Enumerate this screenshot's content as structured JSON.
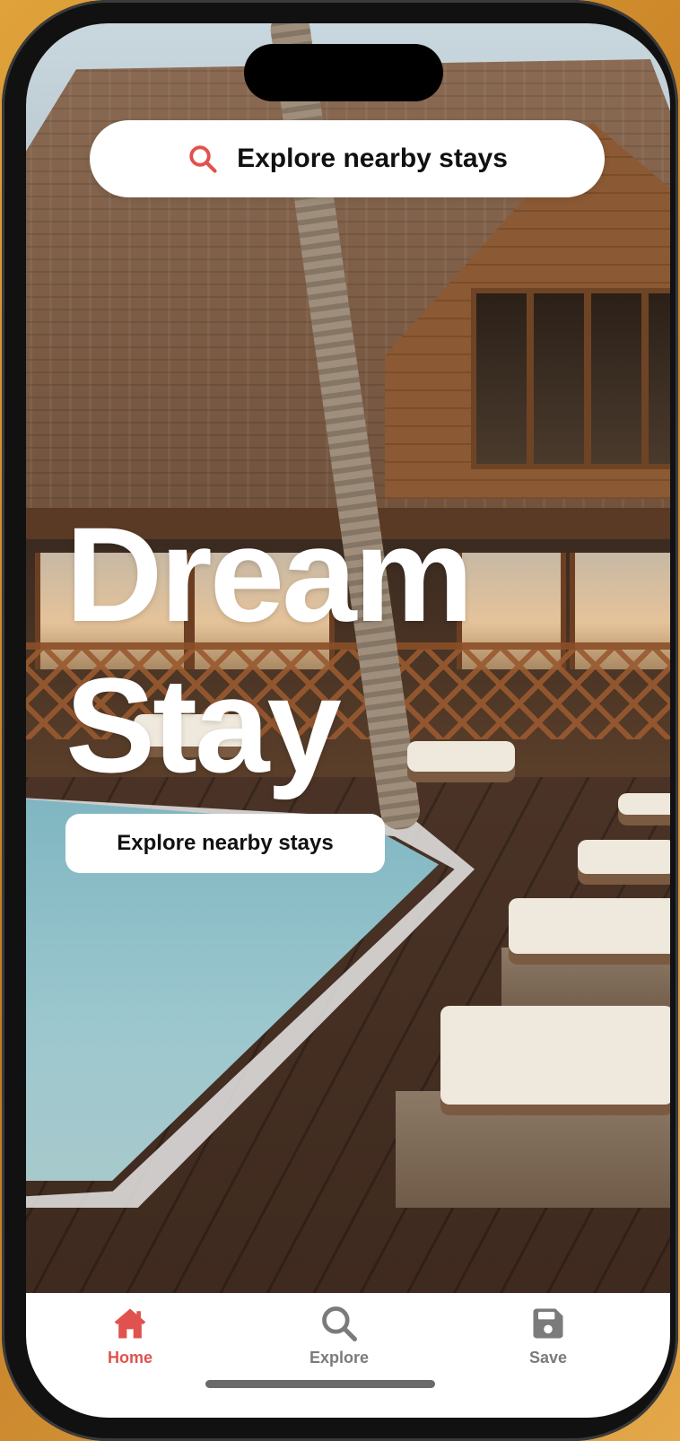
{
  "search_bar": {
    "label": "Explore nearby stays",
    "icon": "search-icon"
  },
  "hero": {
    "line1": "Dream",
    "line2": "Stay"
  },
  "cta": {
    "label": "Explore nearby stays"
  },
  "tabbar": {
    "items": [
      {
        "label": "Home",
        "icon": "home-icon",
        "active": true
      },
      {
        "label": "Explore",
        "icon": "search-icon",
        "active": false
      },
      {
        "label": "Save",
        "icon": "save-icon",
        "active": false
      }
    ]
  },
  "colors": {
    "accent": "#e0524e",
    "inactive": "#7b7b7b",
    "text": "#111111"
  }
}
